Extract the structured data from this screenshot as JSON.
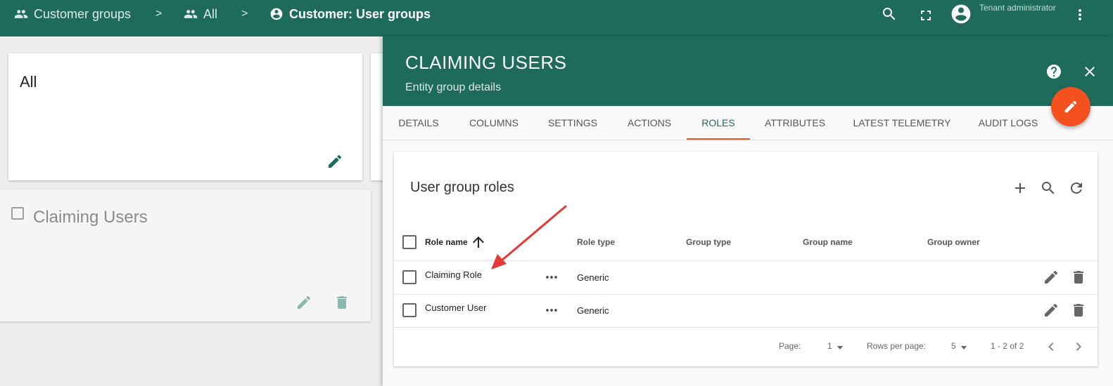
{
  "breadcrumb": {
    "items": [
      {
        "label": "Customer groups",
        "icon": "people-icon"
      },
      {
        "label": "All",
        "icon": "people-icon"
      },
      {
        "label": "Customer: User groups",
        "icon": "account-circle-icon"
      }
    ],
    "separator": ">"
  },
  "header": {
    "user_role": "Tenant administrator",
    "icons": [
      "search-icon",
      "fullscreen-icon",
      "account-circle-icon",
      "more-vert-icon"
    ]
  },
  "groups": {
    "all_card": {
      "title": "All"
    },
    "claiming_card": {
      "title": "Claiming Users"
    }
  },
  "panel": {
    "title": "CLAIMING USERS",
    "subtitle": "Entity group details",
    "tabs": [
      "DETAILS",
      "COLUMNS",
      "SETTINGS",
      "ACTIONS",
      "ROLES",
      "ATTRIBUTES",
      "LATEST TELEMETRY",
      "AUDIT LOGS"
    ],
    "active_tab": "ROLES"
  },
  "roles": {
    "title": "User group roles",
    "columns": {
      "role_name": "Role name",
      "role_type": "Role type",
      "group_type": "Group type",
      "group_name": "Group name",
      "group_owner": "Group owner"
    },
    "rows": [
      {
        "role_name": "Claiming Role",
        "role_type": "Generic",
        "group_type": "",
        "group_name": "",
        "group_owner": ""
      },
      {
        "role_name": "Customer User",
        "role_type": "Generic",
        "group_type": "",
        "group_name": "",
        "group_owner": ""
      }
    ],
    "pager": {
      "page_label": "Page:",
      "page_value": "1",
      "rows_label": "Rows per page:",
      "rows_value": "5",
      "range": "1 - 2 of 2"
    }
  },
  "colors": {
    "primary": "#1e6b5c",
    "accent": "#f4511e",
    "annotation": "#e53935"
  }
}
